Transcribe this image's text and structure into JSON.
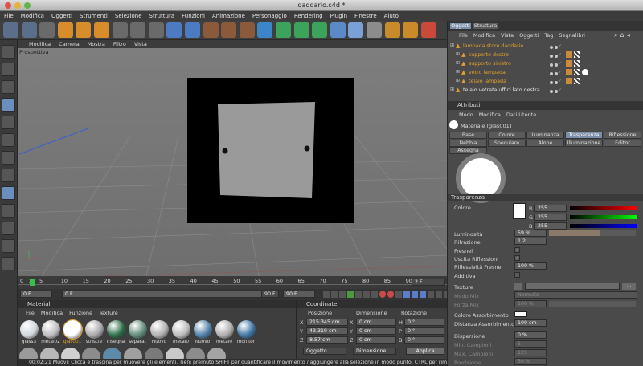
{
  "window": {
    "title": "daddario.c4d *"
  },
  "menubar": [
    "File",
    "Modifica",
    "Oggetti",
    "Strumenti",
    "Selezione",
    "Struttura",
    "Funzioni",
    "Animazione",
    "Personaggio",
    "Rendering",
    "Plugin",
    "Finestre",
    "Aiuto"
  ],
  "toolbar": {
    "icons": [
      "undo-icon",
      "redo-icon",
      "select-arrow-icon",
      "move-icon",
      "scale-icon",
      "rotate-icon",
      "recent-tools-icon",
      "x-axis-icon",
      "y-axis-icon",
      "z-axis-icon",
      "world-coord-icon",
      "render-view-icon",
      "render-picture-viewer-icon",
      "render-settings-icon",
      "cube-primitive-icon",
      "nurbs-icon",
      "array-icon",
      "deformer-icon",
      "scene-icon",
      "light-icon",
      "camera-icon",
      "hair-icon",
      "mograph-icon",
      "sky-icon"
    ]
  },
  "viewport": {
    "menu": [
      "Modifica",
      "Camera",
      "Mostra",
      "Filtro",
      "Vista"
    ],
    "label": "Prospettiva"
  },
  "timeline": {
    "ticks": [
      "0",
      "2",
      "5",
      "10",
      "15",
      "20",
      "25",
      "30",
      "35",
      "40",
      "45",
      "50",
      "55",
      "60",
      "65",
      "70",
      "75",
      "80",
      "85",
      "90"
    ],
    "frame_badge": "2 F",
    "start": "0 F",
    "current": "0 F",
    "end_a": "90 F",
    "end_b": "90 F"
  },
  "materials": {
    "title": "Materiali",
    "menu": [
      "File",
      "Modifica",
      "Funzione",
      "Texture"
    ],
    "items": [
      {
        "name": "glass3",
        "color": "#cfd6dc"
      },
      {
        "name": "metal02",
        "color": "#bdbdbd"
      },
      {
        "name": "glas001",
        "color": "#ffffff",
        "selected": true
      },
      {
        "name": "striscie",
        "color": "#a8a8a8"
      },
      {
        "name": "insegna",
        "color": "#2d6e49"
      },
      {
        "name": "separat",
        "color": "#5f8a78"
      },
      {
        "name": "Nuovo",
        "color": "#b0b0b0"
      },
      {
        "name": "metal0",
        "color": "#bcbcbc"
      },
      {
        "name": "Nuovo",
        "color": "#4f7fa8"
      },
      {
        "name": "metal0",
        "color": "#adadad"
      },
      {
        "name": "monitor",
        "color": "#3f76a3"
      }
    ]
  },
  "coordinates": {
    "title": "Coordinate",
    "headers": [
      "Posizione",
      "Dimensione",
      "Rotazione"
    ],
    "rows": [
      {
        "axis": "X",
        "pos": "215.345 cm",
        "dim_axis": "X",
        "dim": "0 cm",
        "rot_axis": "H",
        "rot": "0 °"
      },
      {
        "axis": "Y",
        "pos": "43.319 cm",
        "dim_axis": "Y",
        "dim": "0 cm",
        "rot_axis": "P",
        "rot": "0 °"
      },
      {
        "axis": "Z",
        "pos": "8.57 cm",
        "dim_axis": "Z",
        "dim": "0 cm",
        "rot_axis": "B",
        "rot": "0 °"
      }
    ],
    "mode_select": "Oggetto",
    "dim_select": "Dimensione",
    "apply_label": "Applica"
  },
  "objects": {
    "tabs": [
      "Oggetti",
      "Struttura"
    ],
    "menu": [
      "File",
      "Modifica",
      "Vista",
      "Oggetti",
      "Tag",
      "Segnalibri"
    ],
    "items": [
      {
        "name": "lampada store daddario",
        "indent": 0
      },
      {
        "name": "supporto destro",
        "indent": 1
      },
      {
        "name": "supporto sinistro",
        "indent": 1
      },
      {
        "name": "vetro lampada",
        "indent": 1
      },
      {
        "name": "telaio lampada",
        "indent": 1
      },
      {
        "name": "telaio vetrata uffici lato destra",
        "indent": 0
      }
    ]
  },
  "attributes": {
    "title": "Attributi",
    "menu": [
      "Modo",
      "Modifica",
      "Dati Utente"
    ],
    "material_name": "Materiale [glas001]",
    "tabs_row1": [
      "Base",
      "Colore",
      "Luminanza",
      "Trasparenza",
      "Riflessione"
    ],
    "tabs_row2": [
      "Nebbia",
      "Speculare",
      "Alone",
      "Illuminazione",
      "Editor"
    ],
    "tabs_row3": [
      "Assegna"
    ],
    "active_tab": "Trasparenza",
    "section": "Trasparenza",
    "colore_label": "Colore",
    "rgb": [
      {
        "ch": "R",
        "value": "255"
      },
      {
        "ch": "G",
        "value": "255"
      },
      {
        "ch": "B",
        "value": "255"
      }
    ],
    "params": [
      {
        "label": "Luminosità",
        "value": "59 %"
      },
      {
        "label": "Rifrazione",
        "value": "1.2"
      },
      {
        "label": "Fresnel",
        "value": "✓"
      },
      {
        "label": "Uscita Riflessioni",
        "value": "✓"
      },
      {
        "label": "Riflessività Fresnel",
        "value": "100 %"
      },
      {
        "label": "Additiva",
        "value": ""
      }
    ],
    "texture_label": "Texture",
    "mix_mode_label": "Modo Mix",
    "mix_mode_value": "Normale",
    "mix_strength_label": "Forza Mix",
    "mix_strength_value": "100 %",
    "absorb_color_label": "Colore Assorbimento",
    "absorb_dist_label": "Distanza Assorbimento",
    "absorb_dist_value": "100 cm",
    "dispersion_label": "Dispersione",
    "dispersion_value": "0 %",
    "min_samples_label": "Min. Campioni",
    "min_samples_value": "5",
    "max_samples_label": "Max. Campioni",
    "max_samples_value": "125",
    "precision_label": "Precisione",
    "precision_value": "50 %"
  },
  "status": {
    "text": "00:02:21   Muovi: Clicca e trascina per muovere gli elementi. Tieni premuto SHIFT per quantificare il movimento / aggiungere alla selezione in modo punto, CTRL per rimuove"
  },
  "colors": {
    "accent": "#7c8fa8",
    "selected_item": "#e3a02a",
    "bg": "#4a4a4a"
  }
}
